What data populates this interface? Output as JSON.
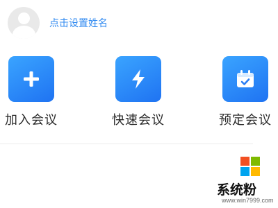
{
  "profile": {
    "name_prompt": "点击设置姓名",
    "avatar_icon": "default-avatar-icon"
  },
  "actions": [
    {
      "label": "加入会议",
      "icon": "plus-icon"
    },
    {
      "label": "快速会议",
      "icon": "lightning-bolt-icon"
    },
    {
      "label": "预定会议",
      "icon": "calendar-check-icon"
    }
  ],
  "colors": {
    "accent": "#2f89f0",
    "tile_gradient_start": "#3aa4ff",
    "tile_gradient_end": "#1f73f2",
    "label_text": "#2a2a2a",
    "divider": "#ececec"
  },
  "watermark": {
    "text": "系统粉",
    "url": "www.win7999.com",
    "logo_icon": "windows-logo-icon",
    "logo_colors": [
      "#f25022",
      "#7fba00",
      "#00a4ef",
      "#ffb900"
    ]
  }
}
